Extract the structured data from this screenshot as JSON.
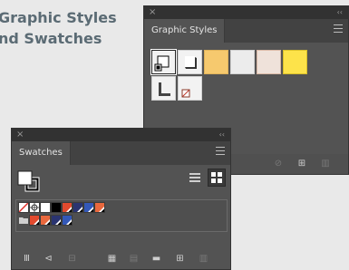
{
  "heading": {
    "line1": "Graphic Styles",
    "line2": "nd Swatches"
  },
  "graphic_styles": {
    "tab_label": "Graphic Styles",
    "close_glyph": "×",
    "collapse_glyph": "‹‹",
    "swatch_colors": [
      "#ffffff",
      "#ffffff",
      "#f6c96e",
      "#efefef",
      "#f1e0d5",
      "#fde34a",
      "#ffffff",
      "#ffffff"
    ]
  },
  "swatches": {
    "tab_label": "Swatches",
    "close_glyph": "×",
    "collapse_glyph": "‹‹",
    "row1_colors": [
      "#ffffff",
      "#ffffff",
      "#cfcfcf",
      "#000000",
      "#e24a2e",
      "#2a3470",
      "#3358b8",
      "#e9683d"
    ],
    "row2_colors": [
      "#e24a2e",
      "#e9683d",
      "#2a3470",
      "#3358b8"
    ]
  }
}
